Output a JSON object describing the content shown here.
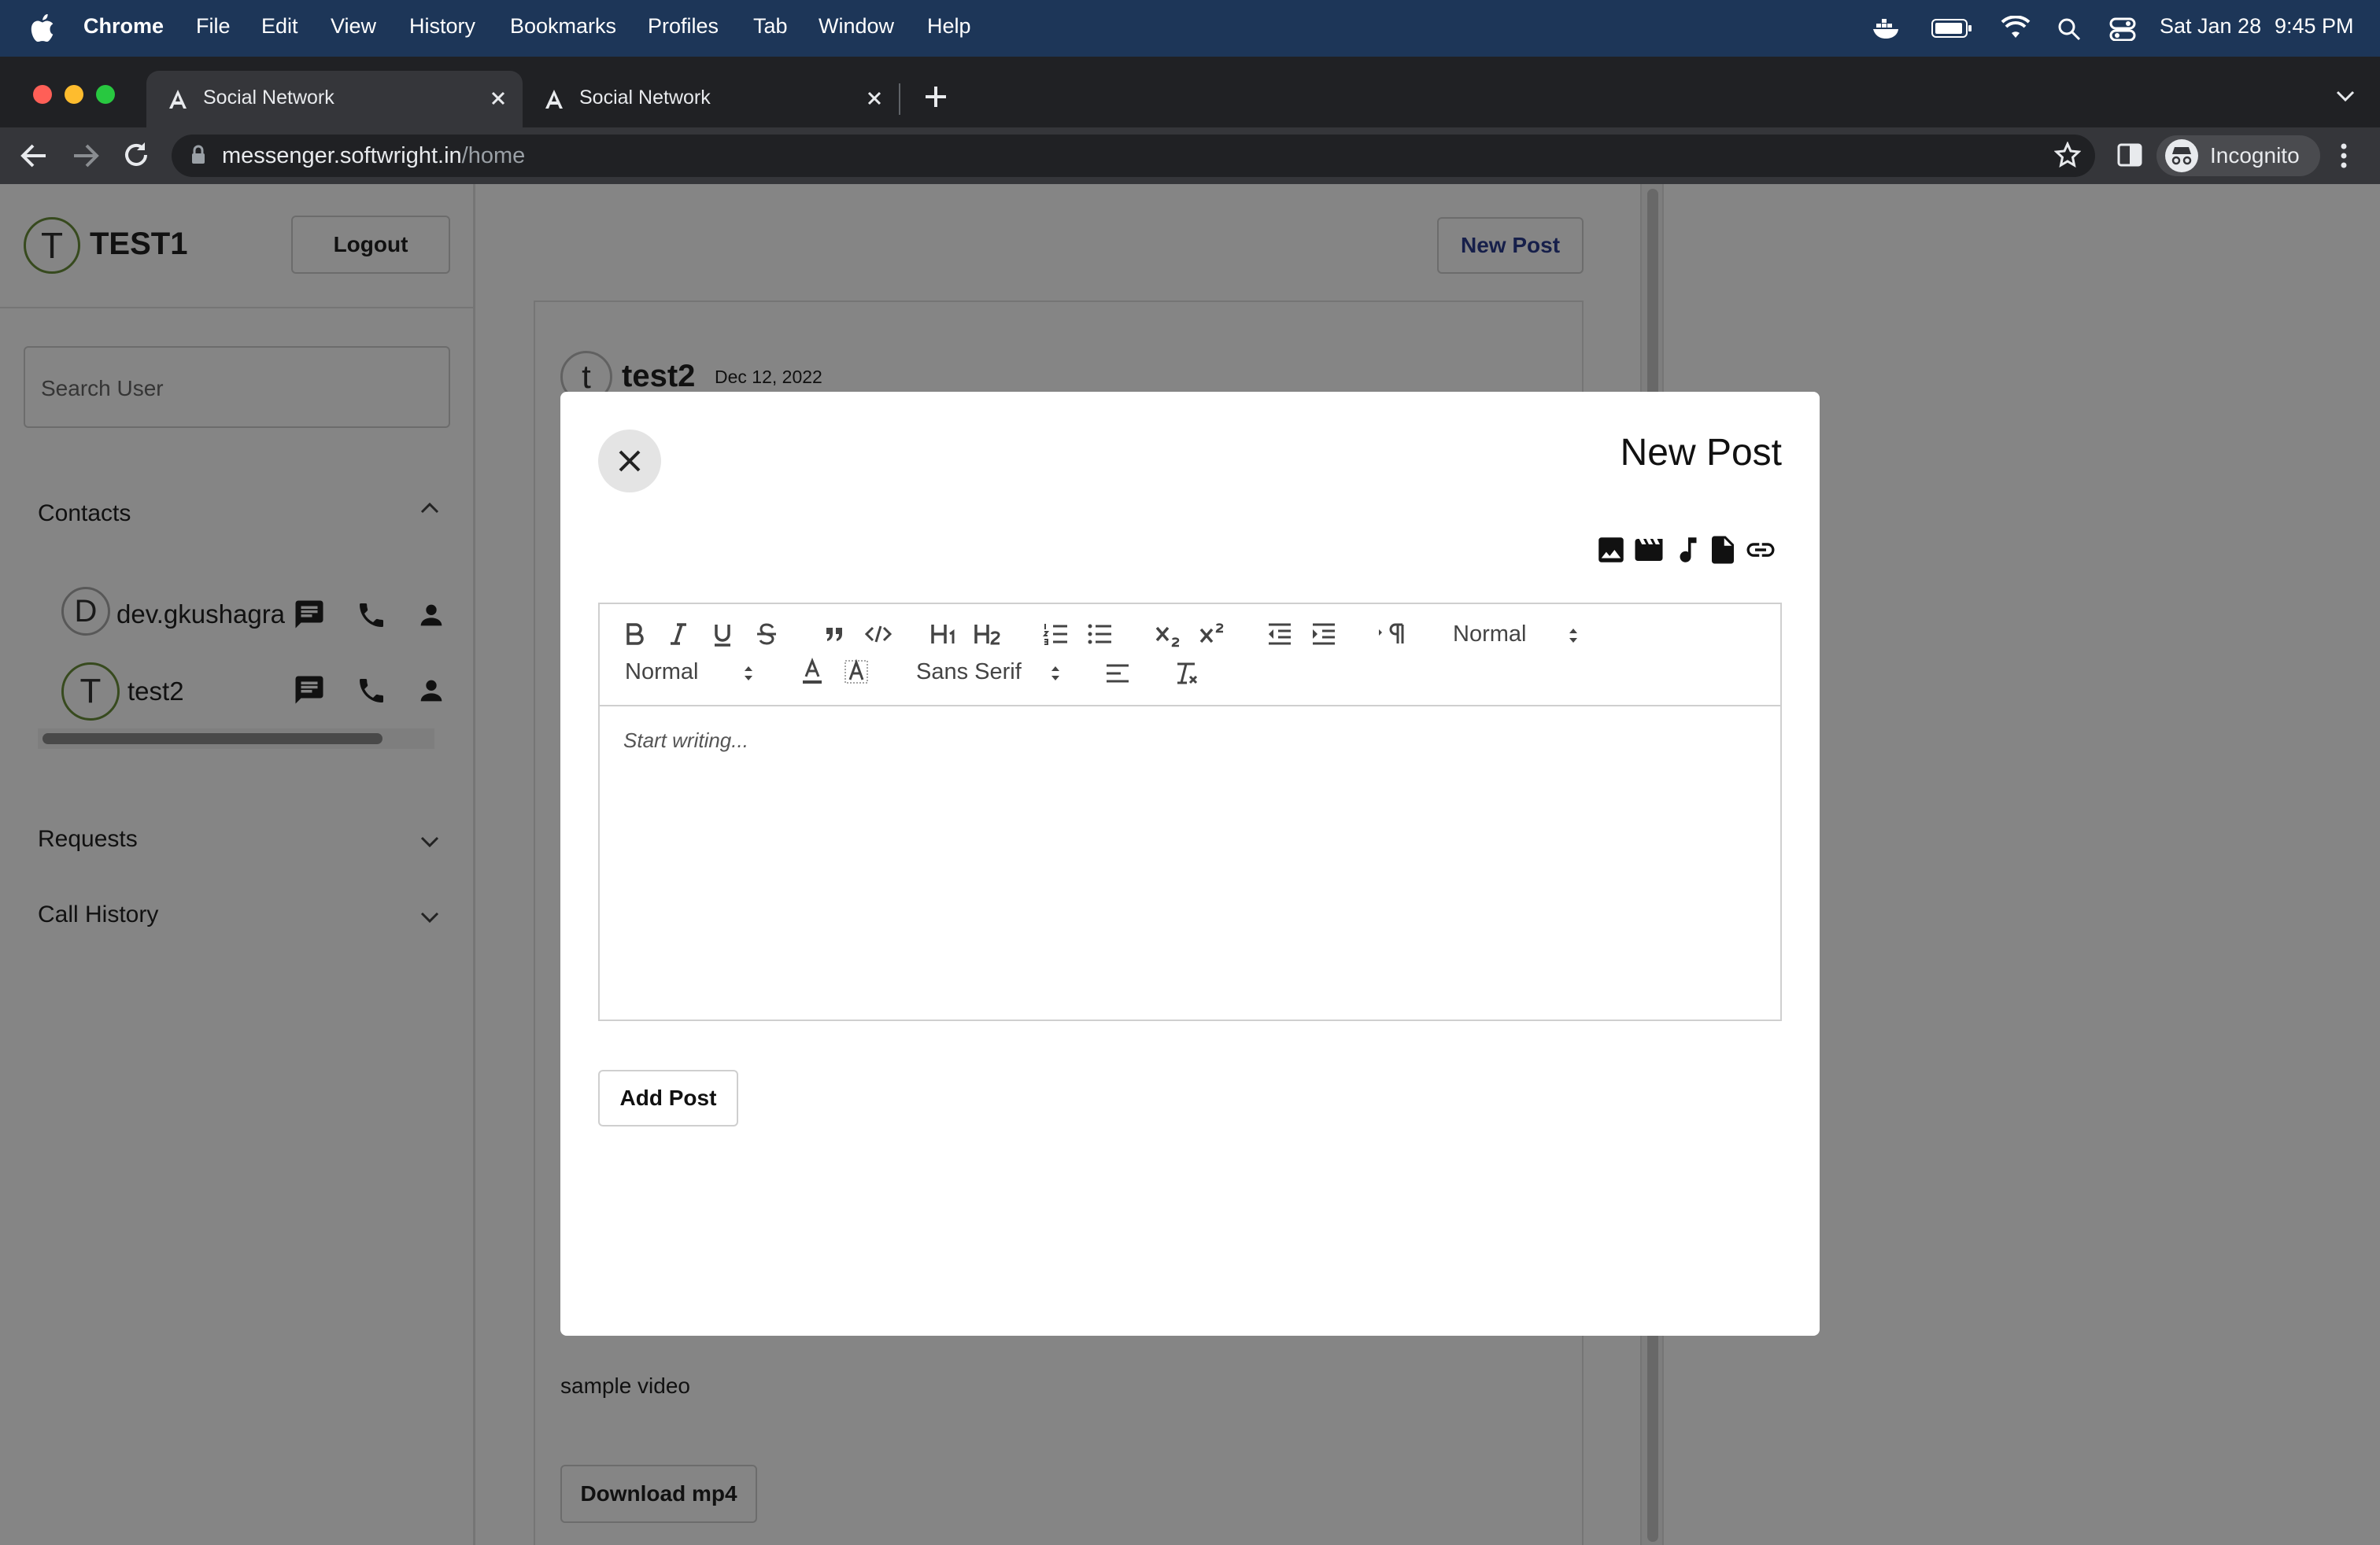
{
  "menubar": {
    "app": "Chrome",
    "items": [
      "File",
      "Edit",
      "View",
      "History",
      "Bookmarks",
      "Profiles",
      "Tab",
      "Window",
      "Help"
    ],
    "date": "Sat Jan 28",
    "time": "9:45 PM"
  },
  "browser": {
    "tabs": [
      {
        "title": "Social Network",
        "active": true
      },
      {
        "title": "Social Network",
        "active": false
      }
    ],
    "url_host": "messenger.softwright.in",
    "url_path": "/home",
    "profile_label": "Incognito"
  },
  "sidebar": {
    "user_initial": "T",
    "username": "TEST1",
    "logout_label": "Logout",
    "search_placeholder": "Search User",
    "contacts_label": "Contacts",
    "contacts": [
      {
        "initial": "D",
        "name": "dev.gkushagra"
      },
      {
        "initial": "T",
        "name": "test2"
      }
    ],
    "requests_label": "Requests",
    "call_history_label": "Call History"
  },
  "feed": {
    "new_post_label": "New Post",
    "post": {
      "initial": "t",
      "author": "test2",
      "date": "Dec 12, 2022",
      "caption": "sample video",
      "download_label": "Download mp4"
    }
  },
  "modal": {
    "title": "New Post",
    "attach_icons": [
      "image-icon",
      "video-icon",
      "audio-icon",
      "document-icon",
      "link-icon"
    ],
    "toolbar": {
      "header_select": "Normal",
      "size_select": "Normal",
      "font_select": "Sans Serif"
    },
    "editor_placeholder": "Start writing...",
    "submit_label": "Add Post"
  },
  "colors": {
    "menubar_bg": "#1d3658",
    "chrome_dark": "#202124",
    "accent_blue": "#2b3c8f",
    "avatar_ring": "#6a8f3a"
  }
}
